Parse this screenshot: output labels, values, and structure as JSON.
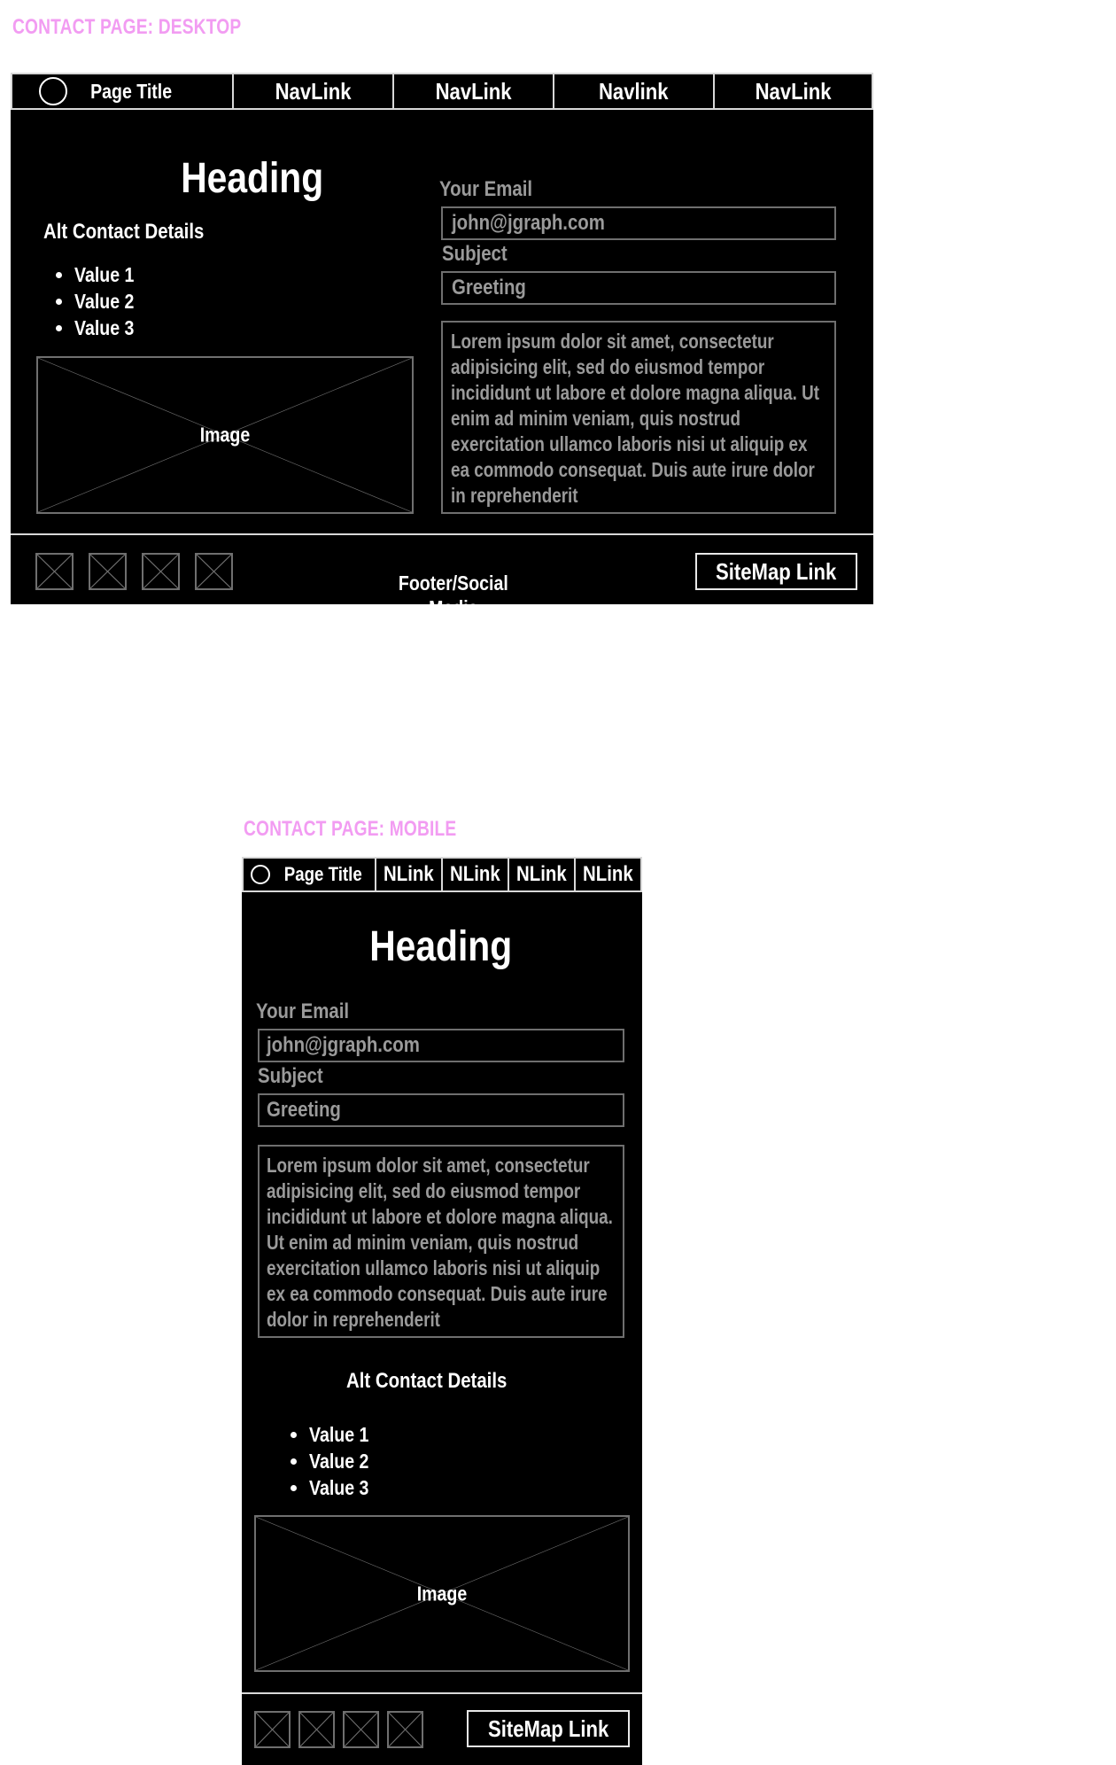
{
  "desktop": {
    "caption": "CONTACT PAGE: DESKTOP",
    "nav": {
      "page_title": "Page Title",
      "links": [
        "NavLink",
        "NavLink",
        "Navlink",
        "NavLink"
      ]
    },
    "heading": "Heading",
    "alt_contact_title": "Alt Contact Details",
    "values": [
      "Value 1",
      "Value 2",
      "Value 3"
    ],
    "image_label": "Image",
    "form": {
      "email_label": "Your Email",
      "email_value": "john@jgraph.com",
      "subject_label": "Subject",
      "subject_value": "Greeting",
      "message": "Lorem ipsum dolor sit amet, consectetur adipisicing elit, sed do eiusmod tempor incididunt ut labore et dolore magna aliqua. Ut enim ad minim veniam, quis nostrud exercitation ullamco laboris nisi ut aliquip ex ea commodo consequat. Duis aute irure dolor in reprehenderit"
    },
    "footer": {
      "text": "Footer/Social\nMedia",
      "sitemap_link": "SiteMap Link"
    }
  },
  "mobile": {
    "caption": "CONTACT PAGE: MOBILE",
    "nav": {
      "page_title": "Page Title",
      "links": [
        "NLink",
        "NLink",
        "NLink",
        "NLink"
      ]
    },
    "heading": "Heading",
    "form": {
      "email_label": "Your Email",
      "email_value": "john@jgraph.com",
      "subject_label": "Subject",
      "subject_value": "Greeting",
      "message": "Lorem ipsum dolor sit amet, consectetur adipisicing elit, sed do eiusmod tempor incididunt ut labore et dolore magna aliqua. Ut enim ad minim veniam, quis nostrud exercitation ullamco laboris nisi ut aliquip ex ea commodo consequat. Duis aute irure dolor in reprehenderit"
    },
    "alt_contact_title": "Alt Contact Details",
    "values": [
      "Value 1",
      "Value 2",
      "Value 3"
    ],
    "image_label": "Image",
    "footer": {
      "sitemap_link": "SiteMap Link"
    }
  }
}
